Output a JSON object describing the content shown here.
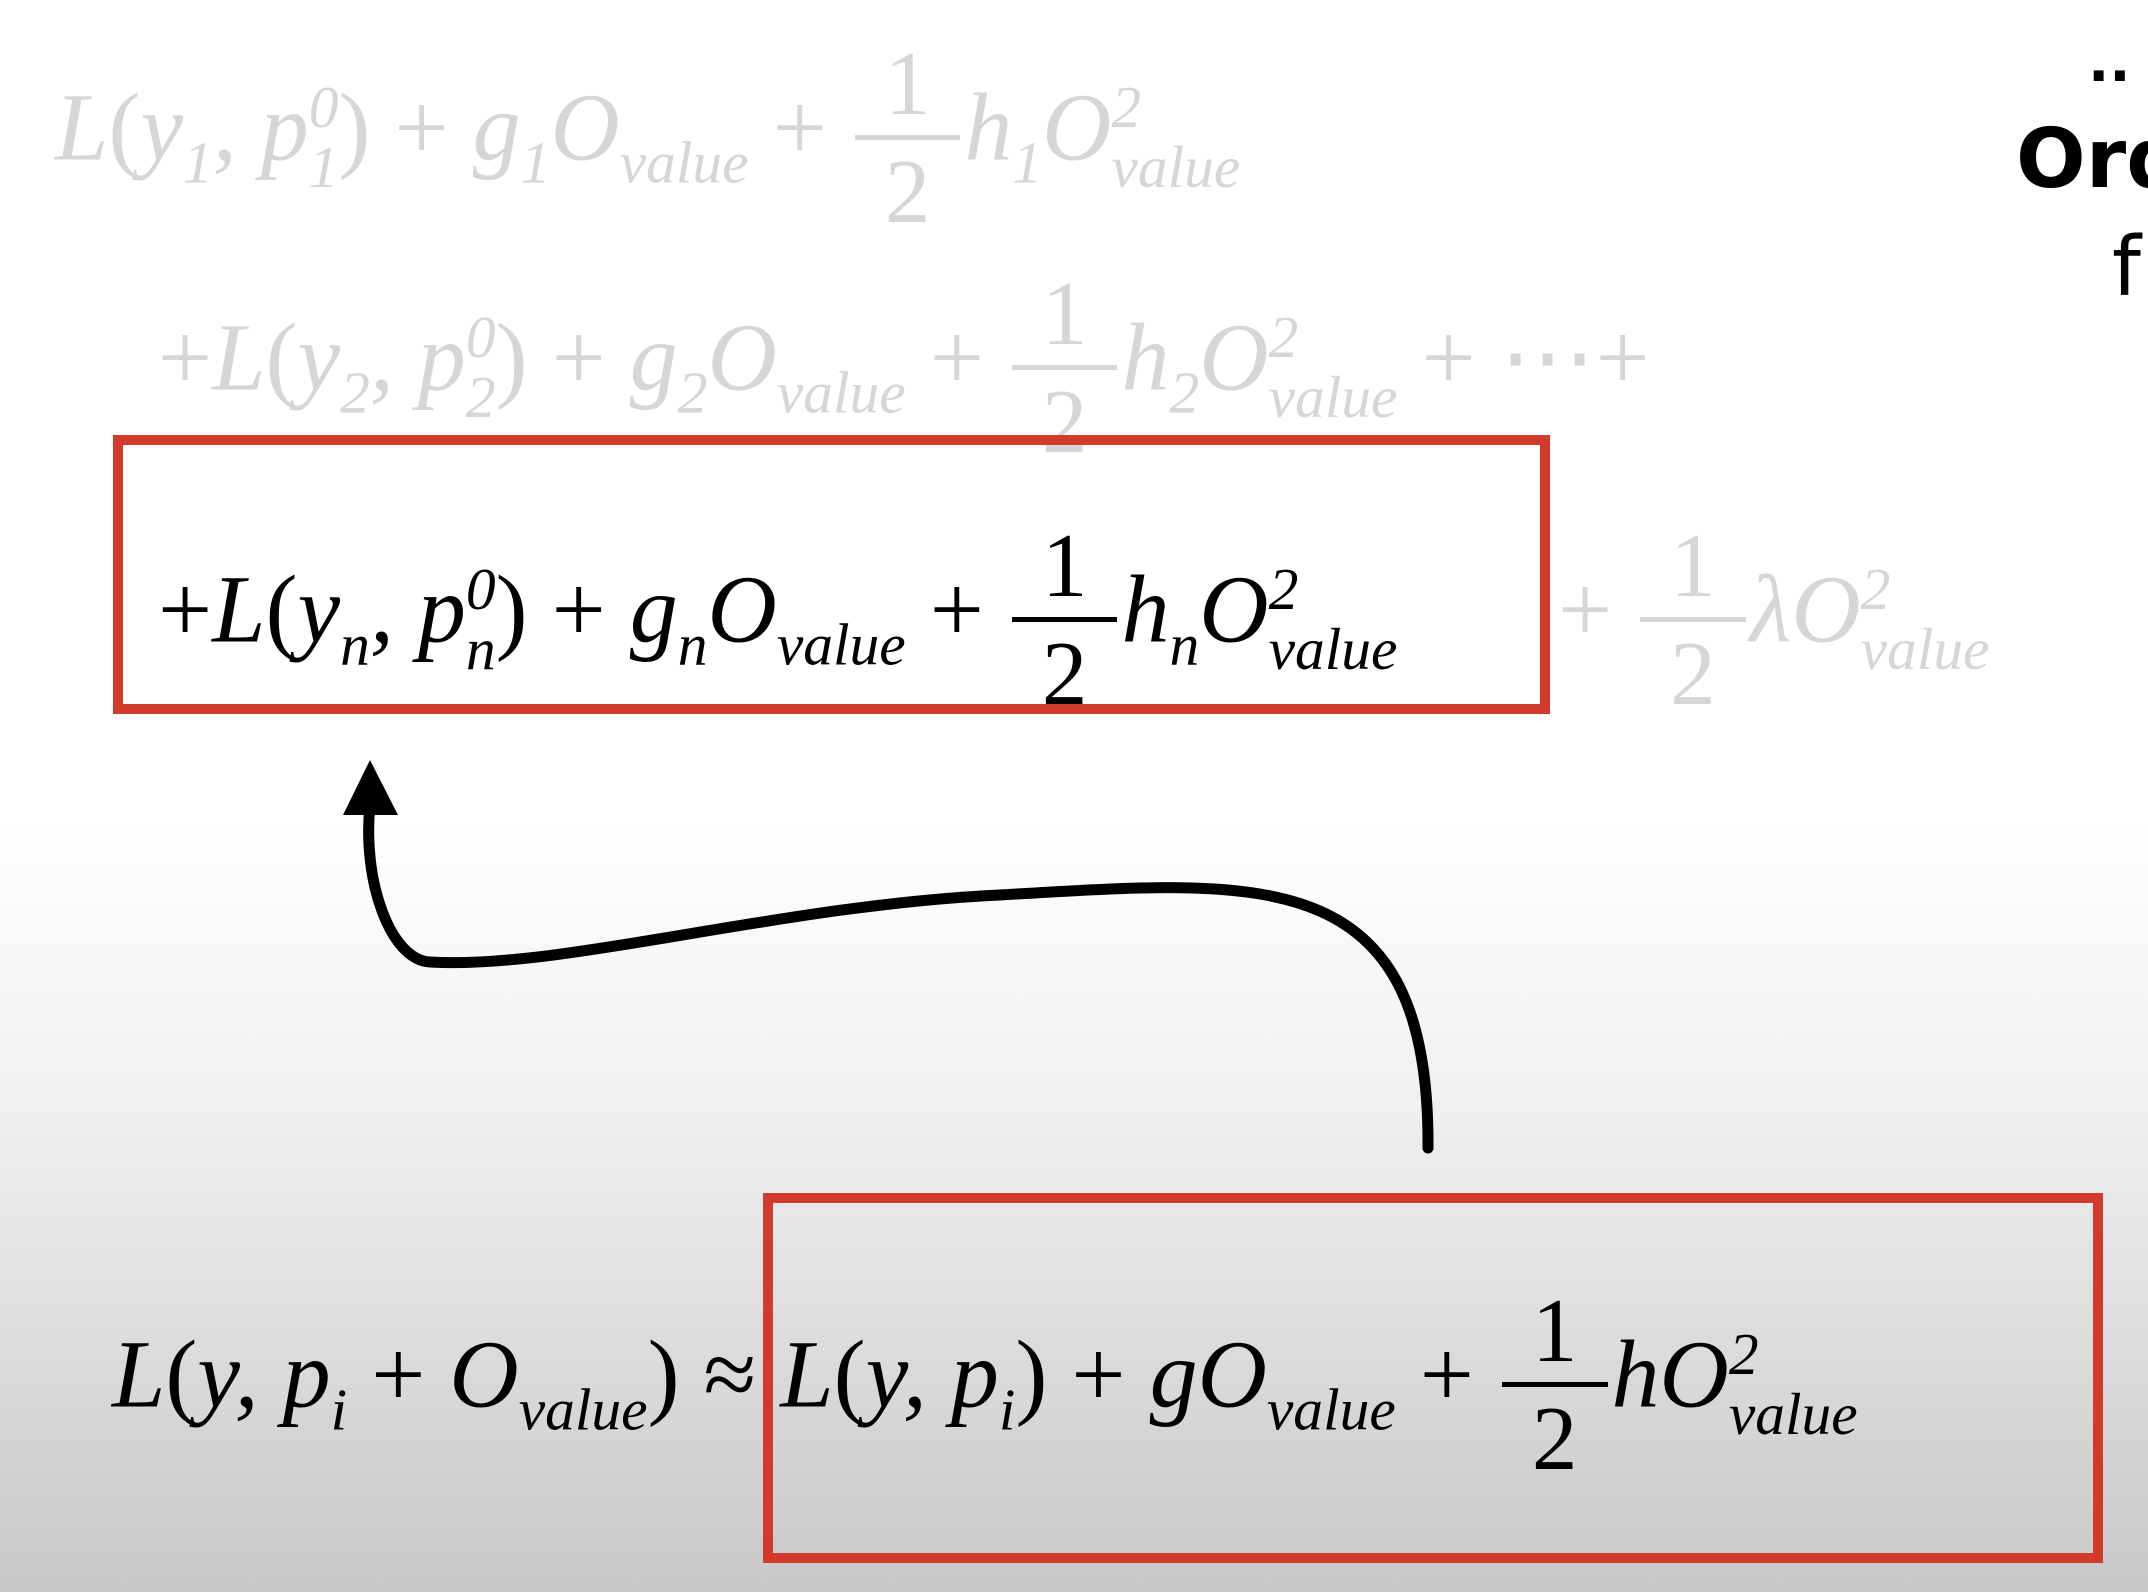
{
  "equations": {
    "line1": {
      "loss": "L",
      "y_sub": "1",
      "p_sub": "1",
      "p_sup": "0",
      "g_sub": "1",
      "O_sub": "value",
      "frac_num": "1",
      "frac_den": "2",
      "h_sub": "1",
      "O2_sup": "2",
      "O2_sub": "value"
    },
    "line2": {
      "y_sub": "2",
      "p_sub": "2",
      "p_sup": "0",
      "g_sub": "2",
      "O_sub": "value",
      "frac_num": "1",
      "frac_den": "2",
      "h_sub": "2",
      "O2_sup": "2",
      "O2_sub": "value",
      "ellipsis": "⋯"
    },
    "line_n": {
      "y_sub": "n",
      "p_sub": "n",
      "p_sup": "0",
      "g_sub": "n",
      "O_sub": "value",
      "frac_num": "1",
      "frac_den": "2",
      "h_sub": "n",
      "O2_sup": "2",
      "O2_sub": "value"
    },
    "regularizer": {
      "frac_num": "1",
      "frac_den": "2",
      "lambda": "λ",
      "O2_sup": "2",
      "O2_sub": "value"
    },
    "taylor": {
      "lhs_p_sub": "i",
      "lhs_O_sub": "value",
      "rhs_p_sub": "i",
      "rhs_O_sub": "value",
      "frac_num": "1",
      "frac_den": "2",
      "O2_sup": "2",
      "O2_sub": "value"
    }
  },
  "side_text": {
    "dots": "..",
    "order": "Ord",
    "fragment": "f"
  },
  "colors": {
    "highlight_box": "#d23b2c",
    "faded_text": "#d6d6d6",
    "arrow": "#000000"
  }
}
